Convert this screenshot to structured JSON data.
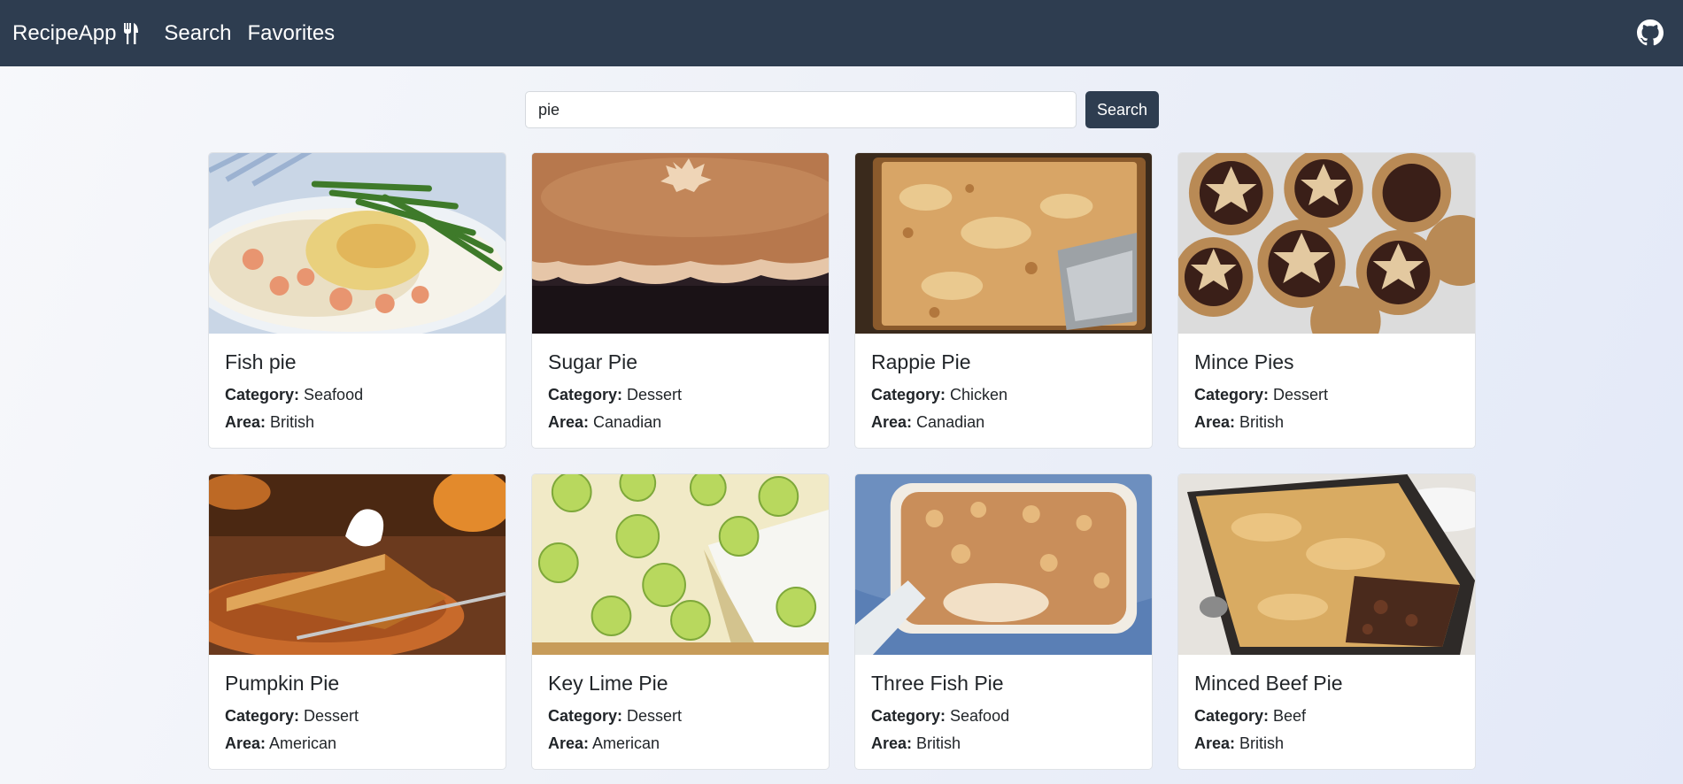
{
  "nav": {
    "brand": "RecipeApp",
    "links": [
      "Search",
      "Favorites"
    ]
  },
  "search": {
    "value": "pie",
    "button": "Search"
  },
  "labels": {
    "category": "Category:",
    "area": "Area:"
  },
  "recipes": [
    {
      "title": "Fish pie",
      "category": "Seafood",
      "area": "British"
    },
    {
      "title": "Sugar Pie",
      "category": "Dessert",
      "area": "Canadian"
    },
    {
      "title": "Rappie Pie",
      "category": "Chicken",
      "area": "Canadian"
    },
    {
      "title": "Mince Pies",
      "category": "Dessert",
      "area": "British"
    },
    {
      "title": "Pumpkin Pie",
      "category": "Dessert",
      "area": "American"
    },
    {
      "title": "Key Lime Pie",
      "category": "Dessert",
      "area": "American"
    },
    {
      "title": "Three Fish Pie",
      "category": "Seafood",
      "area": "British"
    },
    {
      "title": "Minced Beef Pie",
      "category": "Beef",
      "area": "British"
    }
  ],
  "colors": {
    "navbar": "#2e3d50",
    "button": "#2e3d50",
    "card_border": "#dfe2e6"
  }
}
